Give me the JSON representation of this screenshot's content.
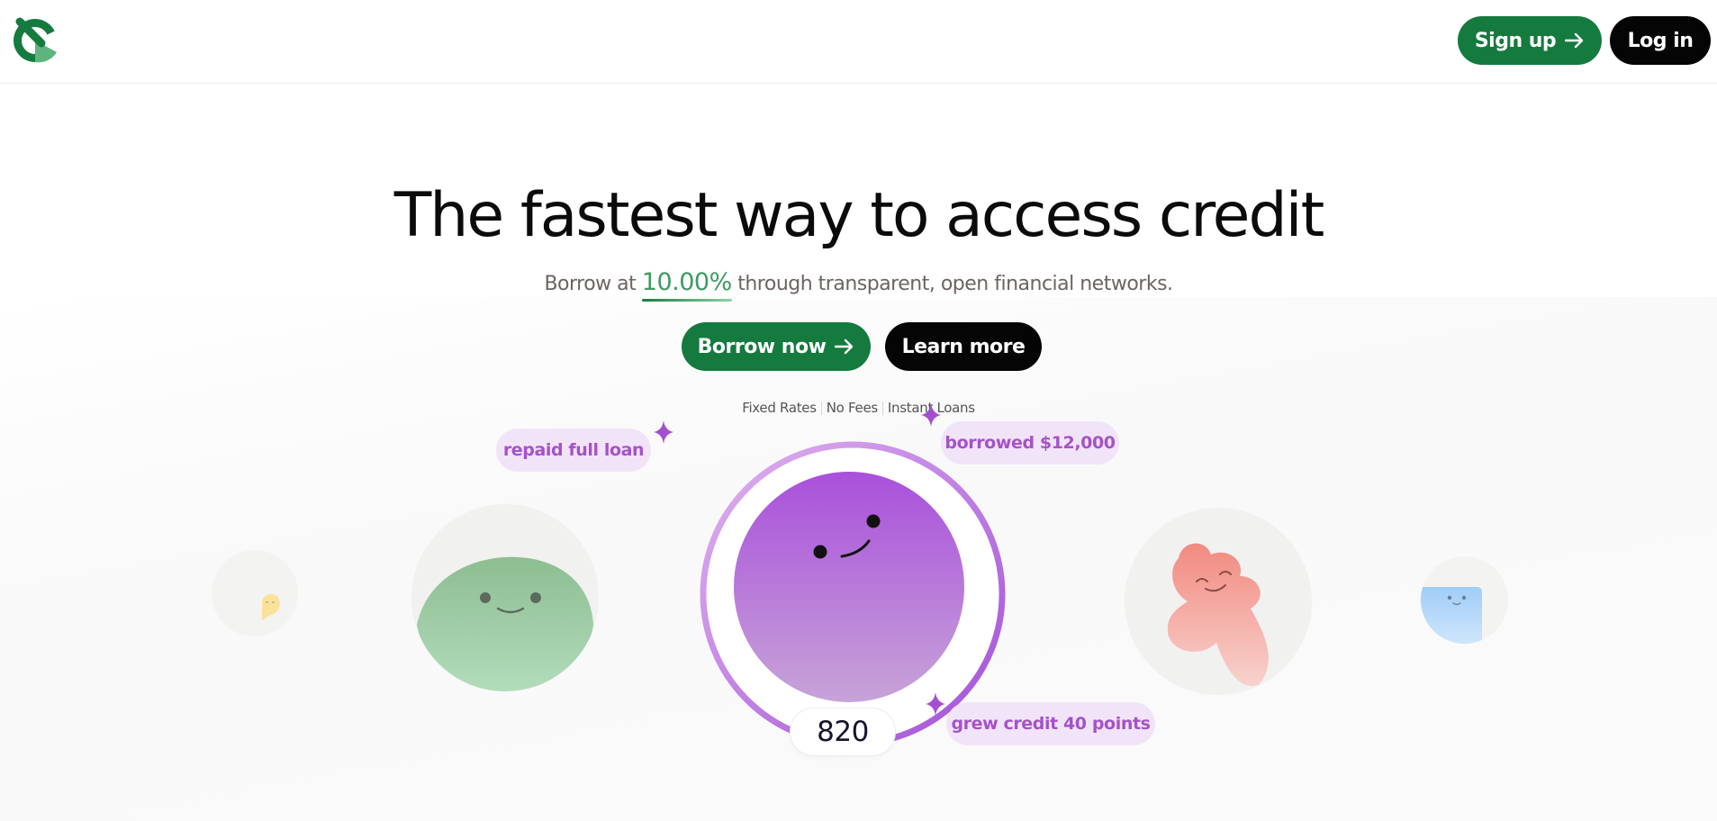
{
  "header": {
    "logo": "brand-logo",
    "signup_label": "Sign up",
    "login_label": "Log in"
  },
  "hero": {
    "title": "The fastest way to access credit",
    "subtitle_before": "Borrow at",
    "rate": "10.00%",
    "subtitle_after": "through transparent, open financial networks.",
    "borrow_label": "Borrow now",
    "learn_label": "Learn more",
    "features": [
      "Fixed Rates",
      "No Fees",
      "Instant Loans"
    ]
  },
  "activity": {
    "repaid": "repaid full loan",
    "borrowed": "borrowed $12,000",
    "grew": "grew credit 40 points",
    "score": "820"
  },
  "colors": {
    "brand_green": "#157a3e",
    "black": "#050505",
    "rate_green": "#3e9a61",
    "pill_bg": "#f2e4f8",
    "pill_text": "#a552c9",
    "ring_purple": "#a64fdc"
  },
  "icons": [
    "arrow-right-icon",
    "sparkle-icon",
    "character-purple",
    "character-green",
    "character-coral",
    "character-yellow",
    "character-blue"
  ]
}
